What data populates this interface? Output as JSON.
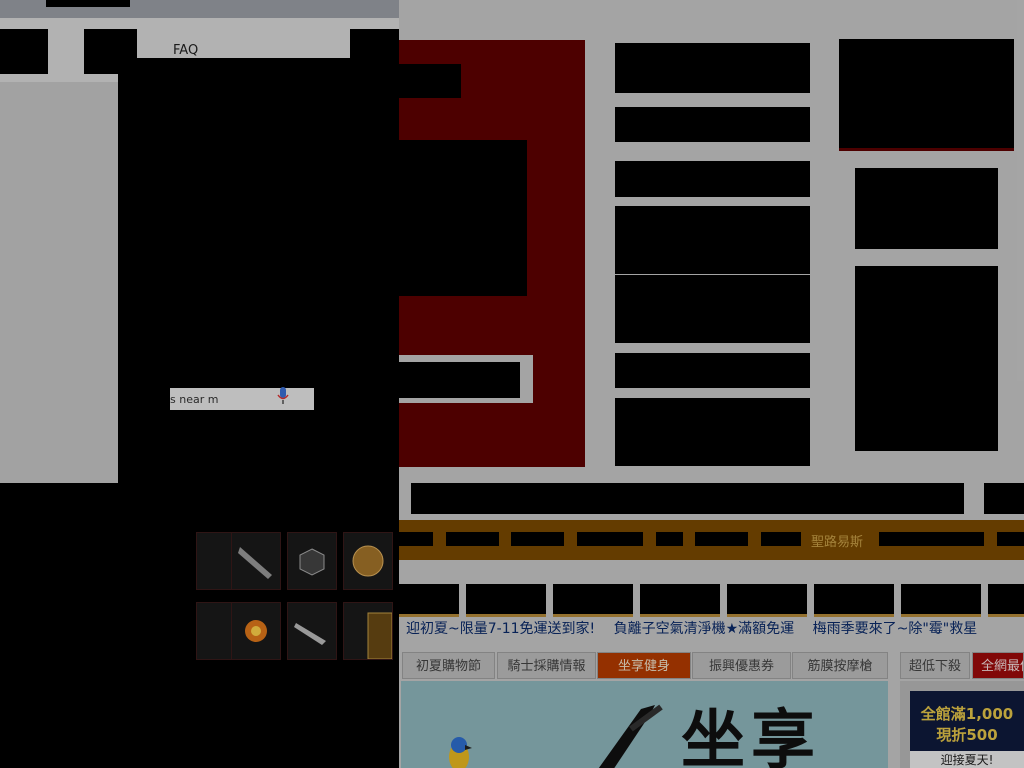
{
  "left_window": {
    "faq_label": "FAQ",
    "search_text": "s near m"
  },
  "shop": {
    "nav_brand": "聖路易斯",
    "ticker": [
      "迎初夏~限量7-11免運送到家!",
      "負離子空氣清淨機★滿額免運",
      "梅雨季要來了~除\"霉\"救星"
    ],
    "tabs": [
      "初夏購物節",
      "騎士採購情報",
      "坐享健身",
      "振興優惠券",
      "筋膜按摩槍",
      "超低下殺",
      "全網最低"
    ],
    "active_tab_index": 2,
    "banner_text": "坐享",
    "promo": {
      "line1": "全館滿1,000",
      "line2": "現折500",
      "line3": "迎接夏天!"
    }
  },
  "colors": {
    "red_panel": "#5e0000",
    "brown_nav": "#7b4a00",
    "active_tab": "#b53b00"
  }
}
